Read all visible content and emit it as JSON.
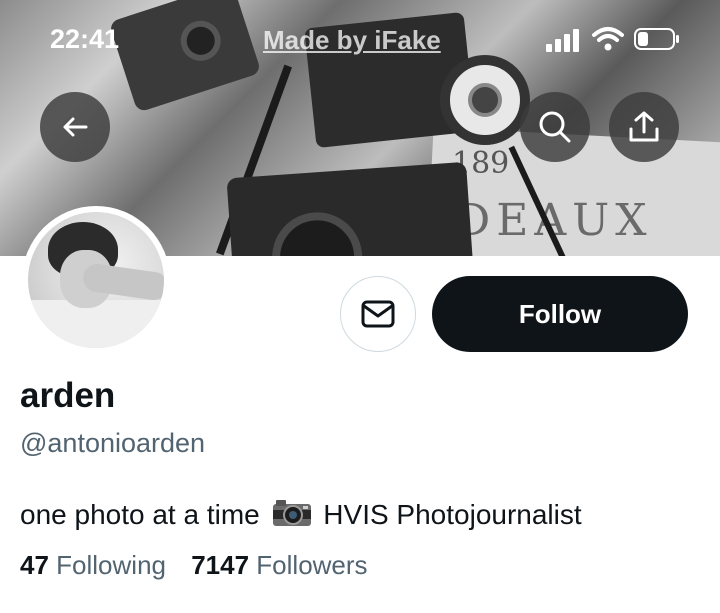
{
  "status_bar": {
    "time": "22:41",
    "watermark": "Made by iFake"
  },
  "header": {
    "back_icon": "arrow-left-icon",
    "search_icon": "search-icon",
    "share_icon": "share-icon"
  },
  "banner": {
    "paper_number": "189",
    "paper_text": "DEAUX"
  },
  "actions": {
    "message_icon": "envelope-icon",
    "follow_label": "Follow"
  },
  "profile": {
    "display_name": "arden",
    "handle": "@antonioarden",
    "bio_before": "one photo at a time",
    "bio_after": "HVIS Photojournalist",
    "following_count": "47",
    "following_label": "Following",
    "followers_count": "7147",
    "followers_label": "Followers"
  },
  "colors": {
    "primary_text": "#0f1419",
    "secondary_text": "#536471",
    "follow_bg": "#0f1419",
    "border": "#cfd9de"
  }
}
